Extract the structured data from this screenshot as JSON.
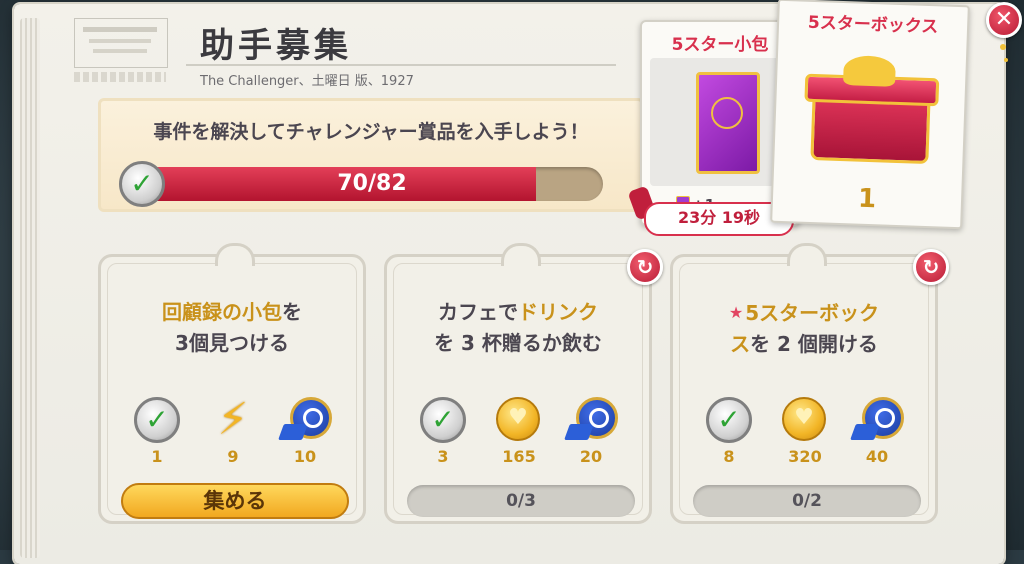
{
  "header": {
    "title": "助手募集",
    "subtitle": "The Challenger、土曜日 版、1927"
  },
  "banner": {
    "text": "事件を解決してチャレンジャー賞品を入手しよう！",
    "progress_label": "70/82",
    "progress_fraction": 0.854
  },
  "pack_reward": {
    "title": "5スター小包",
    "plus": "+1",
    "timer": "23分 19秒"
  },
  "box_reward": {
    "title": "5スターボックス",
    "count": "1"
  },
  "tasks": [
    {
      "title_part1": "回顧録の小包",
      "title_part2": "を",
      "title_line2": "3個見つける",
      "rewards": [
        "1",
        "9",
        "10"
      ],
      "action": "集める"
    },
    {
      "title_part1": "カフェで",
      "title_part2": "ドリンク",
      "title_line2": "を 3 杯贈るか飲む",
      "rewards": [
        "3",
        "165",
        "20"
      ],
      "progress": "0/3"
    },
    {
      "title_part1": "5スターボック",
      "title_line2a": "ス",
      "title_line2b": "を 2 個開ける",
      "rewards": [
        "8",
        "320",
        "40"
      ],
      "progress": "0/2"
    }
  ],
  "icons": {
    "check": "✓",
    "close": "✕",
    "refresh": "↻",
    "bolt": "⚡",
    "star": "★"
  },
  "colors": {
    "progress_fill": "#c01f3c",
    "highlight": "#c9921b",
    "accent_red": "#d8304d"
  }
}
